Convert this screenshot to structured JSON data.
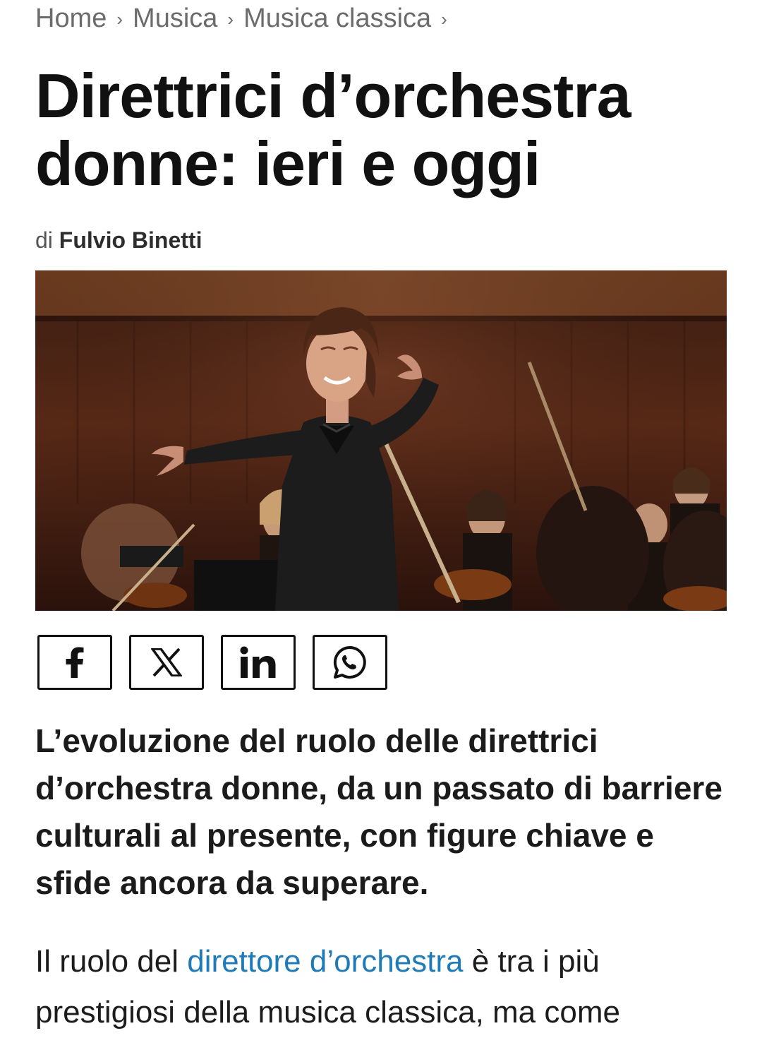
{
  "breadcrumb": {
    "items": [
      "Home",
      "Musica",
      "Musica classica"
    ],
    "separator": "›"
  },
  "article": {
    "title_line1": "Direttrici d’orchestra",
    "title_line2": "donne: ieri e oggi",
    "byline_prefix": "di",
    "author": "Fulvio Binetti",
    "lead": "L’evoluzione del ruolo delle direttrici d’orchestra donne, da un passato di barriere culturali al presente, con figure chiave e sfide ancora da superare.",
    "body_before_link": "Il ruolo del ",
    "body_link": "direttore d’orchestra",
    "body_after_link": " è tra i più prestigiosi della musica classica, ma come"
  },
  "share": {
    "buttons": [
      {
        "network": "facebook",
        "icon": "facebook-icon",
        "glyph": "f"
      },
      {
        "network": "x",
        "icon": "x-icon",
        "glyph": "𝕏"
      },
      {
        "network": "linkedin",
        "icon": "linkedin-icon",
        "glyph": "in"
      },
      {
        "network": "whatsapp",
        "icon": "whatsapp-icon",
        "glyph": ""
      }
    ]
  },
  "colors": {
    "link": "#1f7ab8",
    "text": "#141414",
    "breadcrumb": "#6b6b6b"
  }
}
